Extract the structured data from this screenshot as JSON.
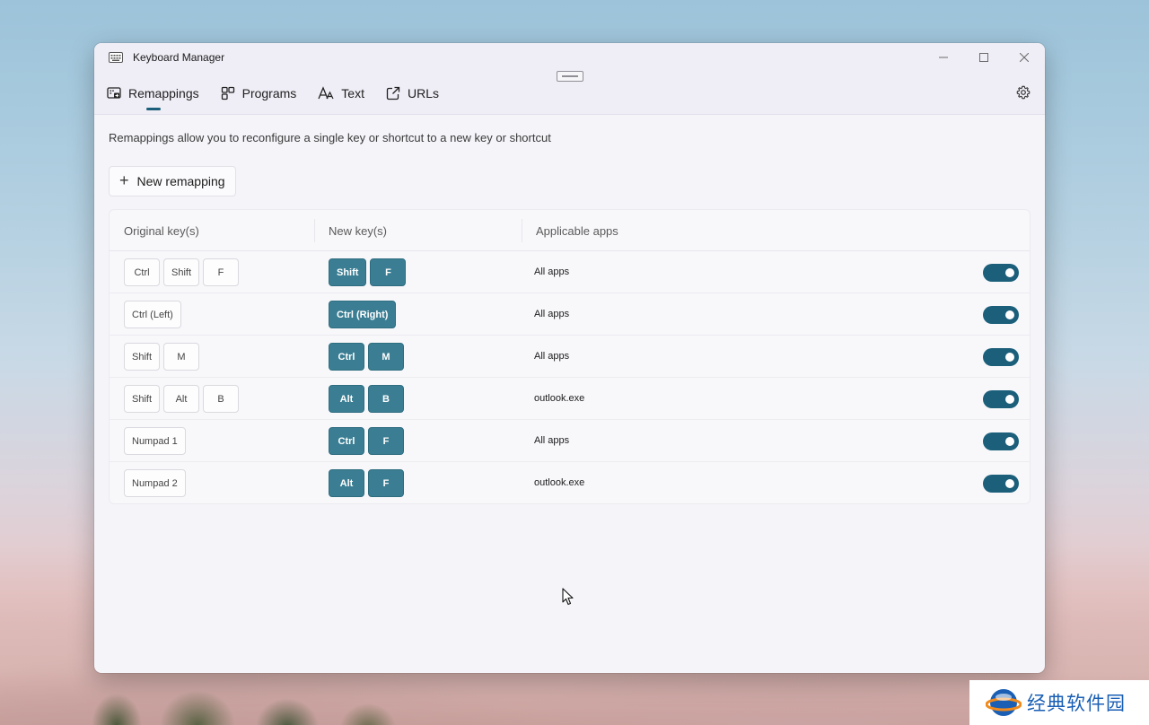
{
  "window": {
    "title": "Keyboard Manager",
    "icon": "keyboard-icon",
    "controls": [
      "minimize-icon",
      "maximize-icon",
      "close-icon"
    ]
  },
  "tabs": [
    {
      "label": "Remappings",
      "icon": "remap-icon",
      "active": true
    },
    {
      "label": "Programs",
      "icon": "programs-icon",
      "active": false
    },
    {
      "label": "Text",
      "icon": "text-icon",
      "active": false
    },
    {
      "label": "URLs",
      "icon": "link-icon",
      "active": false
    }
  ],
  "settings_icon": "gear-icon",
  "description": "Remappings allow you to reconfigure a single key or shortcut to a new key or shortcut",
  "new_button": {
    "label": "New remapping",
    "icon": "plus-icon"
  },
  "table": {
    "headers": [
      "Original key(s)",
      "New key(s)",
      "Applicable apps"
    ],
    "rows": [
      {
        "original": [
          "Ctrl",
          "Shift",
          "F"
        ],
        "new": [
          "Shift",
          "F"
        ],
        "apps": "All apps",
        "enabled": true
      },
      {
        "original": [
          "Ctrl (Left)"
        ],
        "new": [
          "Ctrl (Right)"
        ],
        "apps": "All apps",
        "enabled": true
      },
      {
        "original": [
          "Shift",
          "M"
        ],
        "new": [
          "Ctrl",
          "M"
        ],
        "apps": "All apps",
        "enabled": true
      },
      {
        "original": [
          "Shift",
          "Alt",
          "B"
        ],
        "new": [
          "Alt",
          "B"
        ],
        "apps": "outlook.exe",
        "enabled": true
      },
      {
        "original": [
          "Numpad 1"
        ],
        "new": [
          "Ctrl",
          "F"
        ],
        "apps": "All apps",
        "enabled": true
      },
      {
        "original": [
          "Numpad 2"
        ],
        "new": [
          "Alt",
          "F"
        ],
        "apps": "outlook.exe",
        "enabled": true
      }
    ]
  },
  "colors": {
    "accent": "#1b5f7a",
    "new_key_bg": "#3b7e93",
    "window_bg": "#f5f4f9"
  },
  "watermark": {
    "text": "经典软件园"
  }
}
